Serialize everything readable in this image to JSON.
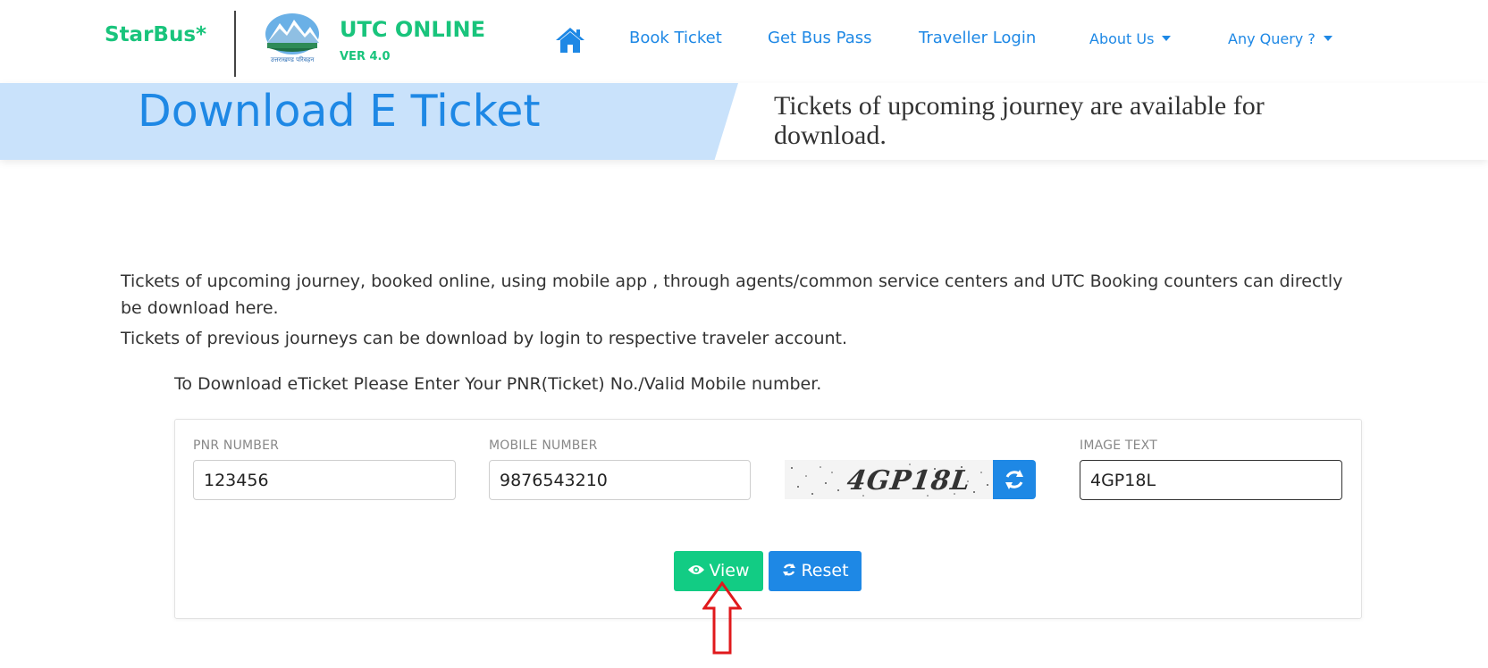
{
  "header": {
    "brand": "StarBus*",
    "logo_caption": "उत्तराखण्ड परिवहन",
    "title": "UTC ONLINE",
    "version": "VER 4.0",
    "nav": {
      "home_icon": "home-icon",
      "book_ticket": "Book Ticket",
      "get_bus_pass": "Get Bus Pass",
      "traveller_login": "Traveller Login",
      "about_us": "About Us",
      "any_query": "Any Query ?"
    }
  },
  "banner": {
    "title": "Download E Ticket",
    "subtitle": "Tickets of upcoming journey are available for download."
  },
  "content": {
    "intro": "Tickets of upcoming journey, booked online, using mobile app , through agents/common service centers and UTC Booking counters can directly be download here.",
    "intro2": "Tickets of previous journeys can be download by login to respective traveler account.",
    "instruction": "To Download eTicket Please Enter Your PNR(Ticket) No./Valid Mobile number."
  },
  "form": {
    "pnr_label": "PNR NUMBER",
    "pnr_value": "123456",
    "mobile_label": "MOBILE NUMBER",
    "mobile_value": "9876543210",
    "captcha_image_text": "4GP18L",
    "image_text_label": "IMAGE TEXT",
    "image_text_value": "4GP18L",
    "view_label": "View",
    "reset_label": "Reset"
  },
  "colors": {
    "brand_green": "#19c47c",
    "link_blue": "#1e88e5",
    "banner_blue": "#c9e2fb",
    "view_button": "#12cc84",
    "annotation_arrow": "#e0191c"
  }
}
